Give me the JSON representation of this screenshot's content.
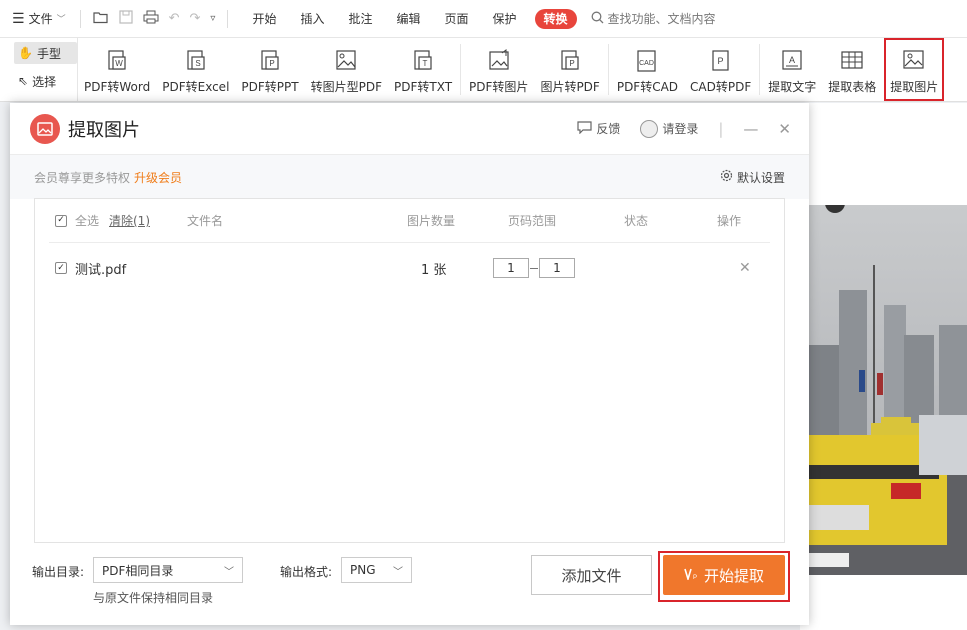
{
  "menubar": {
    "file_label": "文件",
    "tabs": [
      "开始",
      "插入",
      "批注",
      "编辑",
      "页面",
      "保护",
      "转换"
    ],
    "active_tab": "转换",
    "search_label": "查找功能、文档内容"
  },
  "ribbon": {
    "modes": [
      {
        "label": "手型",
        "icon": "hand-icon"
      },
      {
        "label": "选择",
        "icon": "cursor-icon"
      }
    ],
    "tools": [
      {
        "label": "PDF转Word",
        "icon": "pdf-to-word-icon"
      },
      {
        "label": "PDF转Excel",
        "icon": "pdf-to-excel-icon"
      },
      {
        "label": "PDF转PPT",
        "icon": "pdf-to-ppt-icon"
      },
      {
        "label": "转图片型PDF",
        "icon": "to-image-pdf-icon"
      },
      {
        "label": "PDF转TXT",
        "icon": "pdf-to-txt-icon"
      },
      {
        "label": "PDF转图片",
        "icon": "pdf-to-image-icon"
      },
      {
        "label": "图片转PDF",
        "icon": "image-to-pdf-icon"
      },
      {
        "label": "PDF转CAD",
        "icon": "pdf-to-cad-icon"
      },
      {
        "label": "CAD转PDF",
        "icon": "cad-to-pdf-icon"
      },
      {
        "label": "提取文字",
        "icon": "extract-text-icon"
      },
      {
        "label": "提取表格",
        "icon": "extract-table-icon"
      },
      {
        "label": "提取图片",
        "icon": "extract-image-icon"
      }
    ]
  },
  "dialog": {
    "title": "提取图片",
    "feedback_label": "反馈",
    "login_label": "请登录",
    "vip_text": "会员尊享更多特权",
    "upgrade_label": "升级会员",
    "settings_label": "默认设置",
    "table": {
      "select_all_label": "全选",
      "clear_label": "清除(1)",
      "headers": {
        "filename": "文件名",
        "image_count": "图片数量",
        "page_range": "页码范围",
        "status": "状态",
        "action": "操作"
      },
      "rows": [
        {
          "filename": "测试.pdf",
          "image_count": "1 张",
          "page_from": "1",
          "page_to": "1",
          "status": ""
        }
      ]
    },
    "footer": {
      "output_dir_label": "输出目录:",
      "output_dir_value": "PDF相同目录",
      "output_dir_hint": "与原文件保持相同目录",
      "output_format_label": "输出格式:",
      "output_format_value": "PNG",
      "add_file_label": "添加文件",
      "start_label": "开始提取"
    }
  },
  "colors": {
    "accent_red": "#e8453c",
    "start_orange": "#f0772c",
    "upgrade_orange": "#f07d1a",
    "highlight_box": "#d9242b"
  }
}
